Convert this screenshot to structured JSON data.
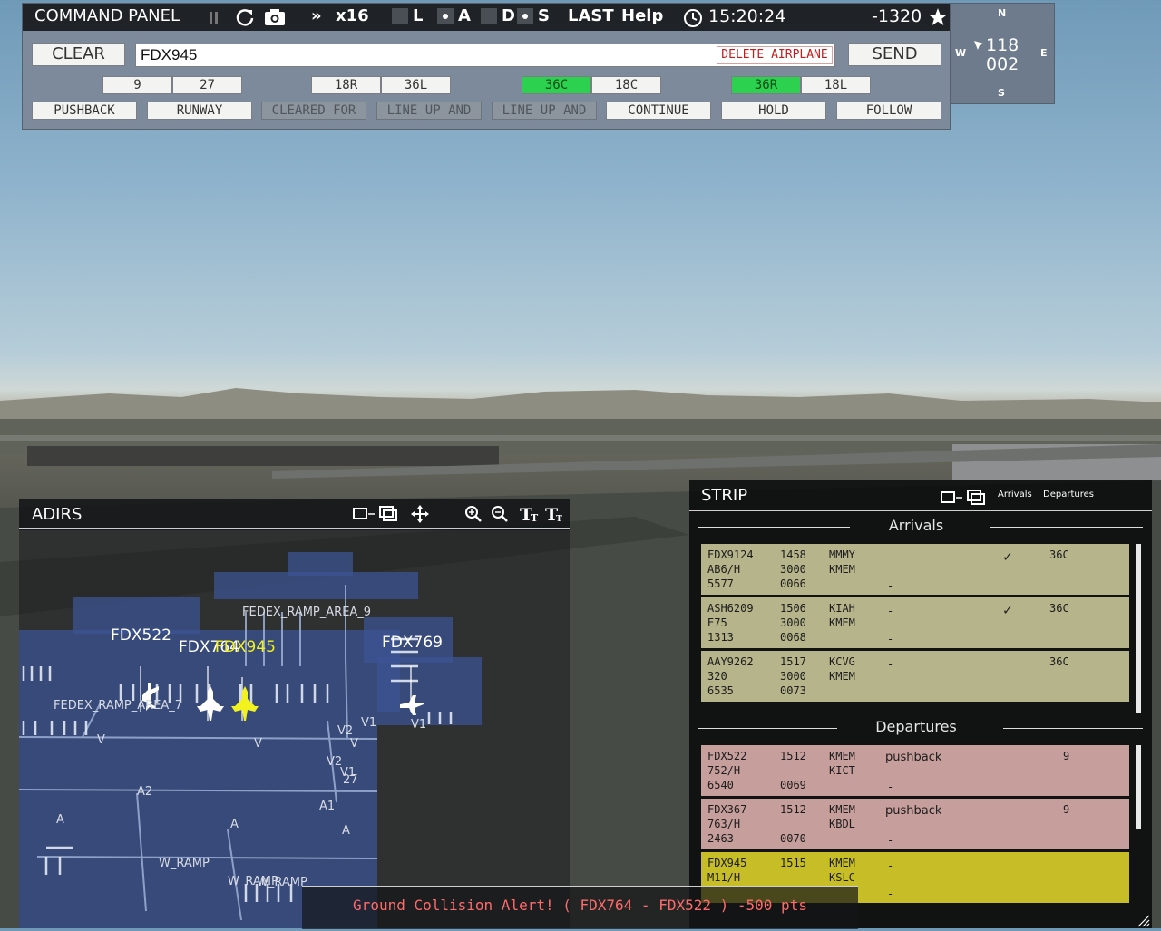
{
  "command_panel": {
    "title": "COMMAND PANEL",
    "pause_icon": "pause-icon",
    "speed_prefix": "»",
    "speed": "x16",
    "toggles": [
      {
        "letter": "L",
        "checked": false
      },
      {
        "letter": "A",
        "checked": true
      },
      {
        "letter": "D",
        "checked": false
      },
      {
        "letter": "S",
        "checked": true
      }
    ],
    "last_label": "LAST",
    "help_label": "Help",
    "time": "15:20:24",
    "score": "-1320",
    "clear_label": "CLEAR",
    "input_value": "FDX945",
    "delete_label": "DELETE AIRPLANE",
    "send_label": "SEND",
    "runways": [
      {
        "label": "9",
        "active": false
      },
      {
        "label": "27",
        "active": false
      },
      {
        "label": "18R",
        "active": false
      },
      {
        "label": "36L",
        "active": false
      },
      {
        "label": "36C",
        "active": true
      },
      {
        "label": "18C",
        "active": false
      },
      {
        "label": "36R",
        "active": true
      },
      {
        "label": "18L",
        "active": false
      }
    ],
    "commands": [
      {
        "label": "PUSHBACK",
        "enabled": true
      },
      {
        "label": "RUNWAY",
        "enabled": true
      },
      {
        "label": "CLEARED FOR",
        "enabled": false
      },
      {
        "label": "LINE UP AND",
        "enabled": false
      },
      {
        "label": "LINE UP AND",
        "enabled": false
      },
      {
        "label": "CONTINUE",
        "enabled": true
      },
      {
        "label": "HOLD",
        "enabled": true
      },
      {
        "label": "FOLLOW",
        "enabled": true
      }
    ]
  },
  "compass": {
    "n": "N",
    "e": "E",
    "s": "S",
    "w": "W",
    "heading": "118",
    "value2": "002"
  },
  "adirs": {
    "title": "ADIRS",
    "icons": [
      "window-detach-icon",
      "move-icon",
      "zoom-in-icon",
      "zoom-out-icon",
      "text-larger-icon",
      "text-smaller-icon"
    ],
    "callsigns": [
      "FDX522",
      "FDX764",
      "FDX945",
      "FDX769"
    ],
    "labels": {
      "fedex_ramp_area_9": "FEDEX_RAMP_AREA_9",
      "fedex_ramp_area_7": "FEDEX_RAMP_AREA_7",
      "v": "V",
      "v1": "V1",
      "v2": "V2",
      "a": "A",
      "a1": "A1",
      "a2": "A2",
      "w_ramp": "W_RAMP",
      "n27": "27"
    }
  },
  "strip": {
    "title": "STRIP",
    "tab_arrivals": "Arrivals",
    "tab_departures": "Departures",
    "arrivals_label": "Arrivals",
    "departures_label": "Departures",
    "arrivals": [
      {
        "callsign": "FDX9124",
        "type": "AB6/H",
        "squawk": "5577",
        "time": "1458",
        "alt": "3000",
        "n": "0066",
        "from": "MMMY",
        "to": "KMEM",
        "status": "-",
        "status2": "-",
        "checked": true,
        "runway": "36C"
      },
      {
        "callsign": "ASH6209",
        "type": "E75",
        "squawk": "1313",
        "time": "1506",
        "alt": "3000",
        "n": "0068",
        "from": "KIAH",
        "to": "KMEM",
        "status": "-",
        "status2": "-",
        "checked": true,
        "runway": "36C"
      },
      {
        "callsign": "AAY9262",
        "type": "320",
        "squawk": "6535",
        "time": "1517",
        "alt": "3000",
        "n": "0073",
        "from": "KCVG",
        "to": "KMEM",
        "status": "-",
        "status2": "-",
        "checked": false,
        "runway": "36C"
      }
    ],
    "departures": [
      {
        "callsign": "FDX522",
        "type": "752/H",
        "squawk": "6540",
        "time": "1512",
        "n": "0069",
        "from": "KMEM",
        "to": "KICT",
        "status": "pushback",
        "status2": "-",
        "runway": "9"
      },
      {
        "callsign": "FDX367",
        "type": "763/H",
        "squawk": "2463",
        "time": "1512",
        "n": "0070",
        "from": "KMEM",
        "to": "KBDL",
        "status": "pushback",
        "status2": "-",
        "runway": "9"
      },
      {
        "callsign": "FDX945",
        "type": "M11/H",
        "squawk": "",
        "time": "1515",
        "n": "",
        "from": "KMEM",
        "to": "KSLC",
        "status": "-",
        "status2": "-",
        "runway": ""
      }
    ]
  },
  "alert": "Ground Collision Alert! ( FDX764 - FDX522 ) -500 pts",
  "colors": {
    "runway_active": "#2bd14f",
    "arrival_strip": "#b6b48a",
    "departure_strip": "#c69e9b",
    "selected_strip": "#c7be27",
    "alert_text": "#ff6a6a",
    "selected_plane": "#f2f21e"
  }
}
